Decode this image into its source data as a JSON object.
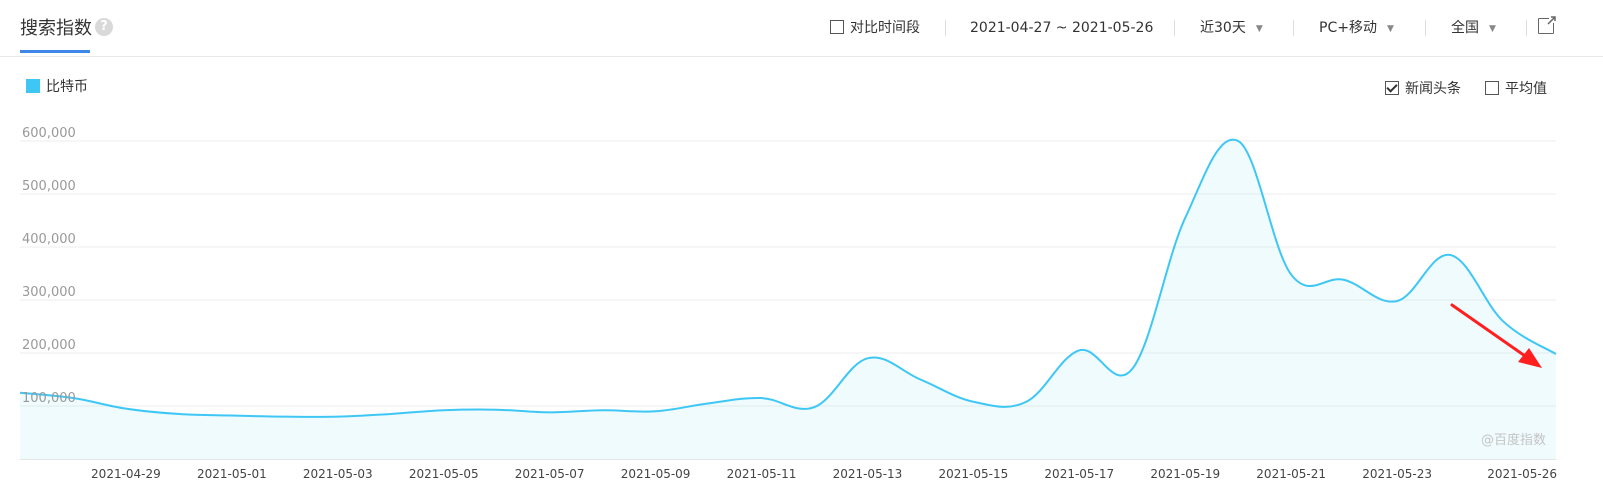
{
  "header": {
    "title": "搜索指数",
    "help_icon": "?",
    "compare_label": "对比时间段",
    "date_range": "2021-04-27 ~ 2021-05-26",
    "period": "近30天",
    "device": "PC+移动",
    "region": "全国"
  },
  "options": {
    "news_label": "新闻头条",
    "news_checked": true,
    "avg_label": "平均值",
    "avg_checked": false
  },
  "watermark": "@百度指数",
  "colors": {
    "series": "#3ec7f5",
    "accent": "#3e87e6",
    "arrow": "#ff1f1f"
  },
  "chart_data": {
    "type": "area",
    "title": "",
    "xlabel": "",
    "ylabel": "",
    "ylim": [
      0,
      600000
    ],
    "yticks": [
      "100,000",
      "200,000",
      "300,000",
      "400,000",
      "500,000",
      "600,000"
    ],
    "grid": true,
    "legend_position": "top-left",
    "x": [
      "2021-04-27",
      "2021-04-28",
      "2021-04-29",
      "2021-04-30",
      "2021-05-01",
      "2021-05-02",
      "2021-05-03",
      "2021-05-04",
      "2021-05-05",
      "2021-05-06",
      "2021-05-07",
      "2021-05-08",
      "2021-05-09",
      "2021-05-10",
      "2021-05-11",
      "2021-05-12",
      "2021-05-13",
      "2021-05-14",
      "2021-05-15",
      "2021-05-16",
      "2021-05-17",
      "2021-05-18",
      "2021-05-19",
      "2021-05-20",
      "2021-05-21",
      "2021-05-22",
      "2021-05-23",
      "2021-05-24",
      "2021-05-25",
      "2021-05-26"
    ],
    "xtick_labels": [
      "2021-04-29",
      "2021-05-01",
      "2021-05-03",
      "2021-05-05",
      "2021-05-07",
      "2021-05-09",
      "2021-05-11",
      "2021-05-13",
      "2021-05-15",
      "2021-05-17",
      "2021-05-19",
      "2021-05-21",
      "2021-05-23",
      "2021-05-26"
    ],
    "series": [
      {
        "name": "比特币",
        "values": [
          125000,
          115000,
          95000,
          85000,
          82000,
          80000,
          80000,
          85000,
          92000,
          93000,
          88000,
          92000,
          90000,
          105000,
          115000,
          98000,
          190000,
          150000,
          108000,
          108000,
          205000,
          170000,
          455000,
          600000,
          348000,
          338000,
          298000,
          385000,
          260000,
          198000
        ]
      }
    ]
  }
}
